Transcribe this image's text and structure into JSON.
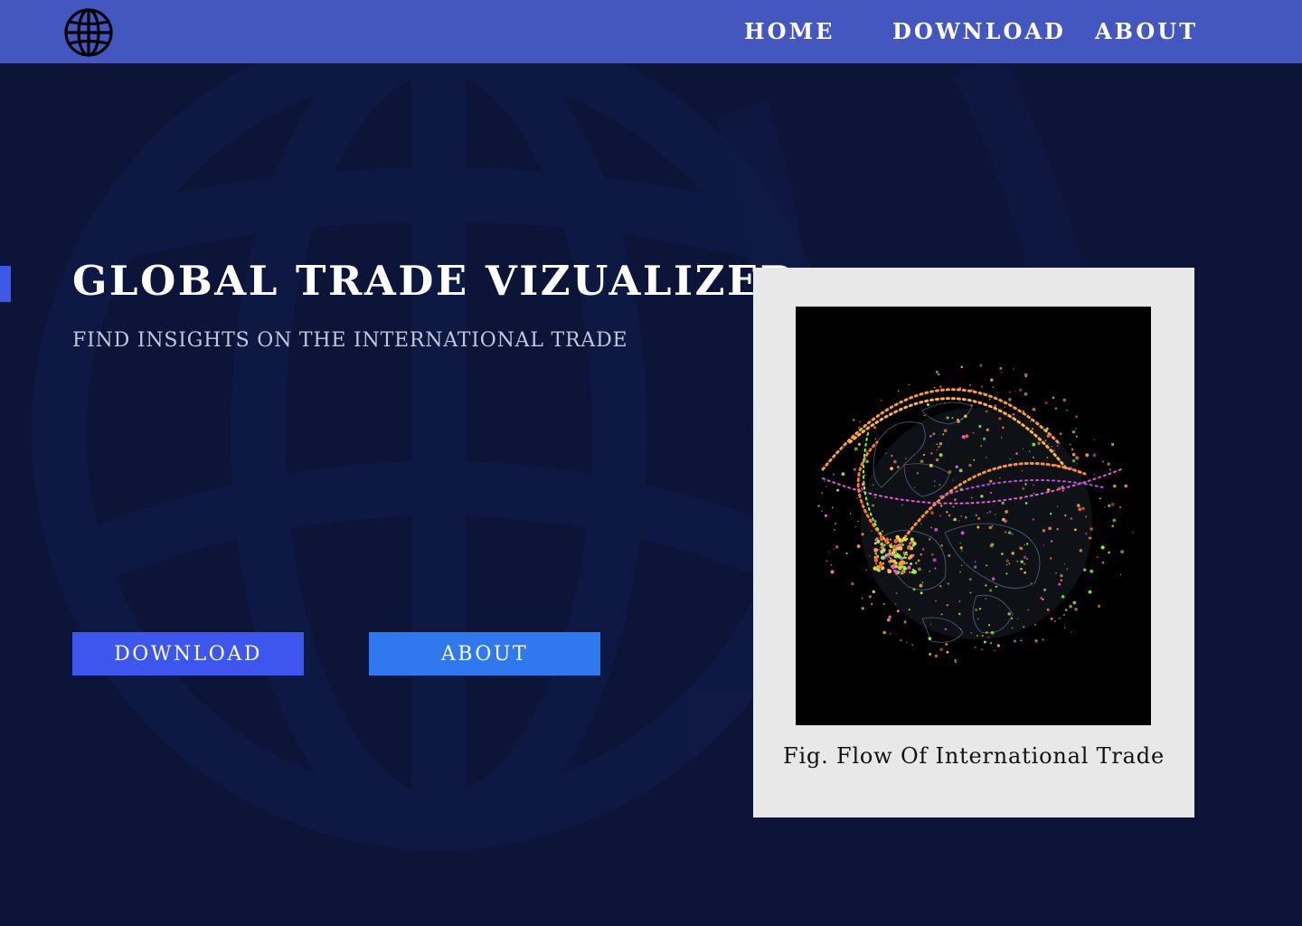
{
  "nav": {
    "logo_icon": "globe-icon",
    "links": [
      "HOME",
      "DOWNLOAD",
      "ABOUT"
    ]
  },
  "hero": {
    "title": "GLOBAL TRADE VIZUALIZER",
    "subtitle": "FIND INSIGHTS ON THE INTERNATIONAL TRADE",
    "buttons": {
      "download": "DOWNLOAD",
      "about": "ABOUT"
    }
  },
  "figure": {
    "caption": "Fig. Flow Of International Trade"
  },
  "colors": {
    "background": "#0c1538",
    "navbar": "#4456c0",
    "accent": "#3d58e8",
    "download_button": "#3d56ee",
    "about_button": "#2f78ee",
    "card": "#e8e8e8"
  }
}
